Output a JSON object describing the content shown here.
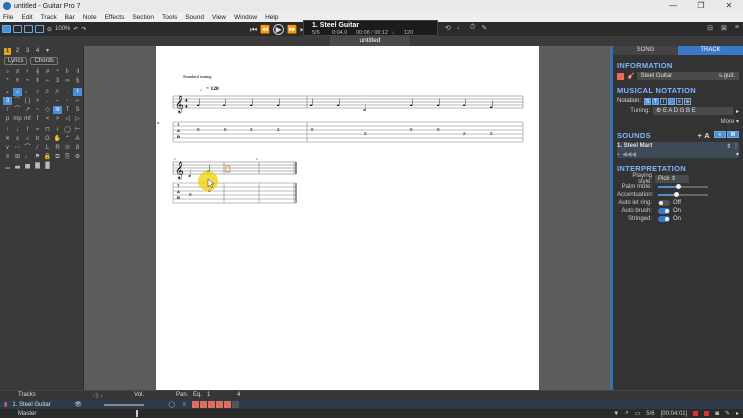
{
  "window": {
    "title": "untitled - Guitar Pro 7",
    "controls": [
      "—",
      "❐",
      "✕"
    ]
  },
  "menu": [
    "File",
    "Edit",
    "Track",
    "Bar",
    "Note",
    "Effects",
    "Section",
    "Tools",
    "Sound",
    "View",
    "Window",
    "Help"
  ],
  "toolbar": {
    "zoom": "100%",
    "transport": [
      "⏮",
      "⏪",
      "⏩",
      "⏭"
    ],
    "play": "▶"
  },
  "lcd": {
    "track": "1. Steel Guitar",
    "bar_position": "5/6",
    "time": "0:04.0",
    "elapsed": "00:08 / 00:12",
    "key": "♩",
    "tempo": "120"
  },
  "document": {
    "tab_title": "untitled"
  },
  "left_panel": {
    "tabs": [
      "1",
      "2",
      "3",
      "4"
    ],
    "active_tab": "1",
    "lyrics_label": "Lyrics",
    "chords_label": "Chords"
  },
  "score": {
    "tuning_label": "Standard tuning",
    "tempo_marking": "= 120",
    "system1_tab_numbers": [
      "0",
      "0",
      "2",
      "2",
      "0",
      "2",
      "0",
      "0",
      "2",
      "2"
    ],
    "system2_tab_numbers": [
      "0",
      "0",
      "0"
    ]
  },
  "right_panel": {
    "tabs": [
      "SONG",
      "TRACK"
    ],
    "active_tab": "TRACK",
    "info_heading": "INFORMATION",
    "track_name": "Steel Guitar",
    "track_short": "s.guit.",
    "notation_heading": "MUSICAL NOTATION",
    "notation_label": "Notation:",
    "tuning_label": "Tuning:",
    "tuning_value": "E A D G B E",
    "more_label": "More ▾",
    "sounds_heading": "SOUNDS",
    "sound_item": "1. Steel Mart",
    "interp_heading": "INTERPRETATION",
    "playing_style_label": "Playing style:",
    "playing_style_value": "Pick",
    "palm_mute_label": "Palm mute:",
    "palm_mute_level": 0.4,
    "accentuation_label": "Accentuation:",
    "accentuation_level": 0.35,
    "auto_let_ring_label": "Auto let ring:",
    "auto_let_ring_value": "Off",
    "auto_brush_label": "Auto brush:",
    "auto_brush_value": "On",
    "stringed_label": "Stringed:",
    "stringed_value": "On"
  },
  "bottom": {
    "tracks_label": "Tracks",
    "vol_label": "Vol.",
    "pan_label": "Pan.",
    "eq_label": "Eq.",
    "ruler": [
      "1",
      "4"
    ],
    "track1": "1. Steel Guitar",
    "master": "Master",
    "status_time": "[00:04:01]",
    "status_bar": "5/6"
  }
}
